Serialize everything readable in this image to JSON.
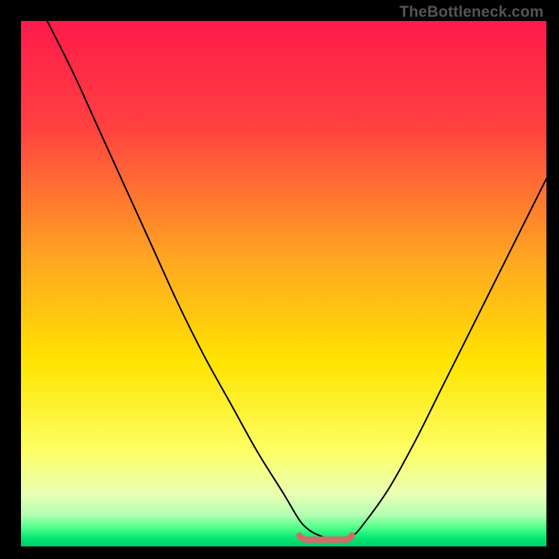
{
  "watermark": "TheBottleneck.com",
  "chart_data": {
    "type": "line",
    "title": "",
    "xlabel": "",
    "ylabel": "",
    "xlim": [
      0,
      100
    ],
    "ylim": [
      0,
      100
    ],
    "grid": false,
    "legend": false,
    "series": [
      {
        "name": "curve",
        "x": [
          5,
          10,
          15,
          20,
          25,
          30,
          35,
          40,
          45,
          50,
          53,
          55,
          57,
          60,
          63,
          65,
          70,
          75,
          80,
          85,
          90,
          95,
          100
        ],
        "values": [
          100,
          90,
          79,
          68,
          57,
          46,
          36,
          27,
          18,
          10,
          5,
          3,
          2,
          1,
          2,
          4,
          11,
          20,
          30,
          40,
          50,
          60,
          70
        ]
      }
    ],
    "background_gradient": {
      "stops": [
        {
          "offset": 0.0,
          "color": "#ff1a4b"
        },
        {
          "offset": 0.2,
          "color": "#ff4040"
        },
        {
          "offset": 0.45,
          "color": "#ffa522"
        },
        {
          "offset": 0.65,
          "color": "#ffe400"
        },
        {
          "offset": 0.82,
          "color": "#fdff66"
        },
        {
          "offset": 0.9,
          "color": "#eaffb3"
        },
        {
          "offset": 0.94,
          "color": "#b3ffb3"
        },
        {
          "offset": 0.965,
          "color": "#4dff88"
        },
        {
          "offset": 0.985,
          "color": "#00e673"
        },
        {
          "offset": 1.0,
          "color": "#00cc66"
        }
      ]
    },
    "bottom_highlight": {
      "color": "#d46a6a",
      "stroke_width": 9,
      "x_range": [
        53,
        63
      ],
      "y_value": 1.3
    }
  }
}
